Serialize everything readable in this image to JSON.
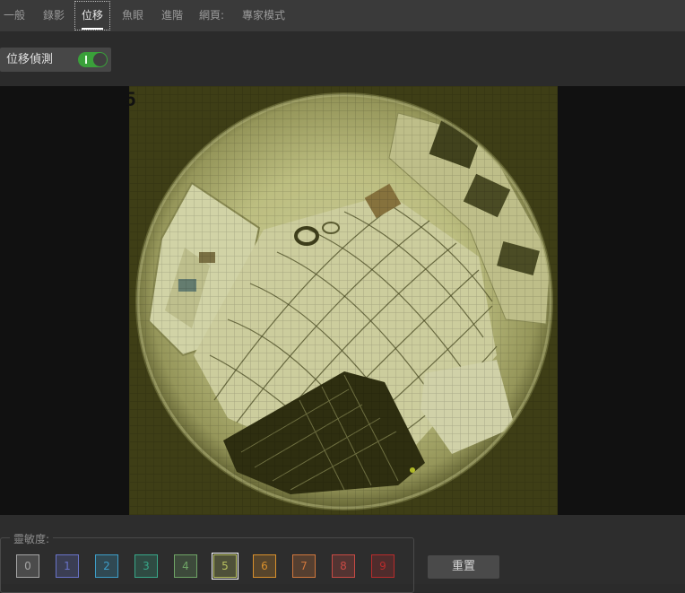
{
  "tabs": [
    {
      "label": "一般",
      "active": false
    },
    {
      "label": "錄影",
      "active": false
    },
    {
      "label": "位移",
      "active": true
    },
    {
      "label": "魚眼",
      "active": false
    },
    {
      "label": "進階",
      "active": false
    },
    {
      "label": "網頁:",
      "active": false
    },
    {
      "label": "專家模式",
      "active": false
    }
  ],
  "motion_detection": {
    "label": "位移偵測",
    "enabled": true
  },
  "video": {
    "sensitivity_overlay": "5"
  },
  "sensitivity": {
    "legend": "靈敏度:",
    "levels": [
      {
        "label": "0",
        "color": "#a6a6a6"
      },
      {
        "label": "1",
        "color": "#6973c9"
      },
      {
        "label": "2",
        "color": "#3d9ec9"
      },
      {
        "label": "3",
        "color": "#38a889"
      },
      {
        "label": "4",
        "color": "#6fa566"
      },
      {
        "label": "5",
        "color": "#b9c160"
      },
      {
        "label": "6",
        "color": "#d9902c"
      },
      {
        "label": "7",
        "color": "#d0773c"
      },
      {
        "label": "8",
        "color": "#c94a44"
      },
      {
        "label": "9",
        "color": "#b92c2c"
      }
    ],
    "selected": "5"
  },
  "reset_label": "重置"
}
